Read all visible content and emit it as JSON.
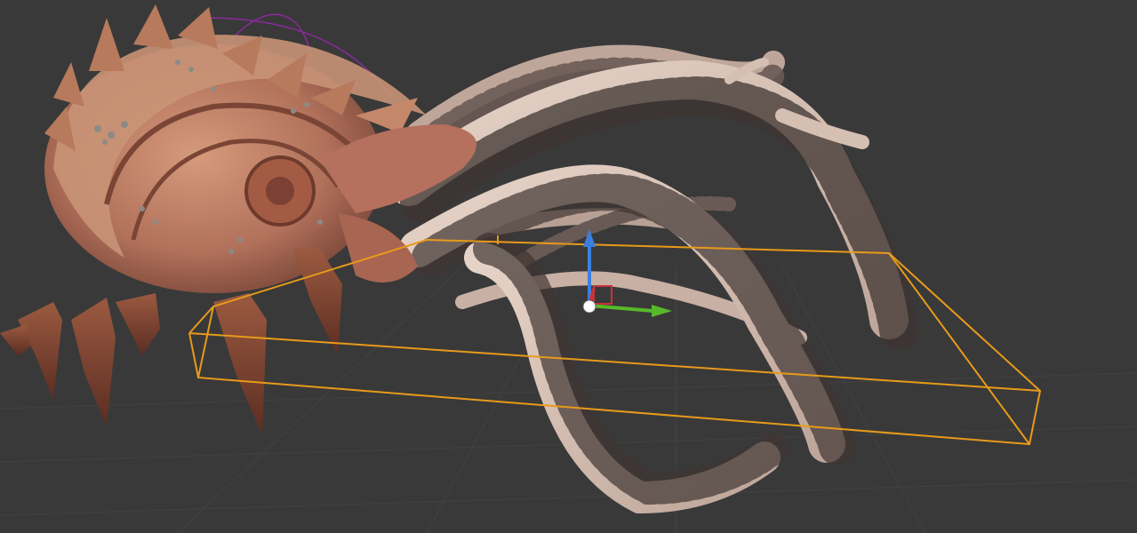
{
  "viewport": {
    "background_color": "#393939",
    "grid_color": "#444444",
    "selection_outline_color": "#e89a1a",
    "rotation_ring_color": "#8a2a9a"
  },
  "object": {
    "description_icon": "kraken-creature-mesh",
    "shell_color": "#b77a5c",
    "tentacle_color": "#d9c3b6",
    "sucker_color": "#6a5a55"
  },
  "gizmo": {
    "x_axis_color": "#c8333a",
    "y_axis_color": "#58b82a",
    "z_axis_color": "#3b7fe0",
    "pivot_color": "#ffffff"
  }
}
